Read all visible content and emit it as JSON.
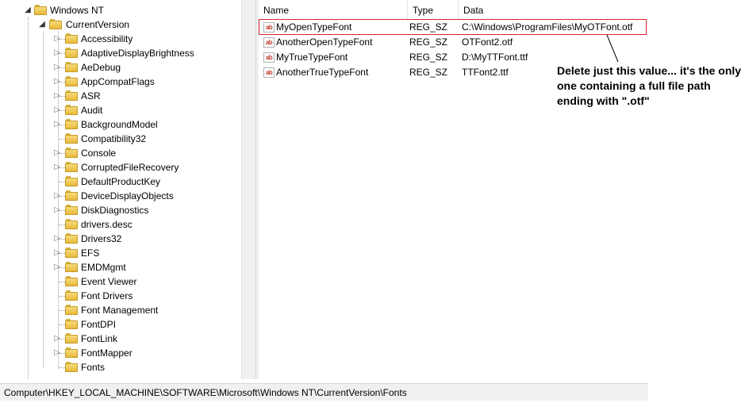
{
  "tree": {
    "windows_nt": "Windows NT",
    "current_version": "CurrentVersion",
    "items": [
      {
        "label": "Accessibility",
        "expandable": true
      },
      {
        "label": "AdaptiveDisplayBrightness",
        "expandable": true
      },
      {
        "label": "AeDebug",
        "expandable": true
      },
      {
        "label": "AppCompatFlags",
        "expandable": true
      },
      {
        "label": "ASR",
        "expandable": true
      },
      {
        "label": "Audit",
        "expandable": true
      },
      {
        "label": "BackgroundModel",
        "expandable": true
      },
      {
        "label": "Compatibility32",
        "expandable": false
      },
      {
        "label": "Console",
        "expandable": true
      },
      {
        "label": "CorruptedFileRecovery",
        "expandable": true
      },
      {
        "label": "DefaultProductKey",
        "expandable": false
      },
      {
        "label": "DeviceDisplayObjects",
        "expandable": true
      },
      {
        "label": "DiskDiagnostics",
        "expandable": true
      },
      {
        "label": "drivers.desc",
        "expandable": false
      },
      {
        "label": "Drivers32",
        "expandable": true
      },
      {
        "label": "EFS",
        "expandable": true
      },
      {
        "label": "EMDMgmt",
        "expandable": true
      },
      {
        "label": "Event Viewer",
        "expandable": false
      },
      {
        "label": "Font Drivers",
        "expandable": false
      },
      {
        "label": "Font Management",
        "expandable": false
      },
      {
        "label": "FontDPI",
        "expandable": false
      },
      {
        "label": "FontLink",
        "expandable": true
      },
      {
        "label": "FontMapper",
        "expandable": true
      },
      {
        "label": "Fonts",
        "expandable": false
      }
    ]
  },
  "list": {
    "columns": [
      "Name",
      "Type",
      "Data"
    ],
    "rows": [
      {
        "name": "MyOpenTypeFont",
        "type": "REG_SZ",
        "data": "C:\\Windows\\ProgramFiles\\MyOTFont.otf"
      },
      {
        "name": "AnotherOpenTypeFont",
        "type": "REG_SZ",
        "data": "OTFont2.otf"
      },
      {
        "name": "MyTrueTypeFont",
        "type": "REG_SZ",
        "data": "D:\\MyTTFont.ttf"
      },
      {
        "name": "AnotherTrueTypeFont",
        "type": "REG_SZ",
        "data": "TTFont2.ttf"
      }
    ]
  },
  "annotation": {
    "text": "Delete just this value... it's the only one containing a full file path ending with \".otf\"",
    "highlight_color": "#d9232e"
  },
  "statusbar": {
    "path": "Computer\\HKEY_LOCAL_MACHINE\\SOFTWARE\\Microsoft\\Windows NT\\CurrentVersion\\Fonts"
  },
  "icons": {
    "value": "string-value-icon",
    "folder": "folder-icon"
  }
}
